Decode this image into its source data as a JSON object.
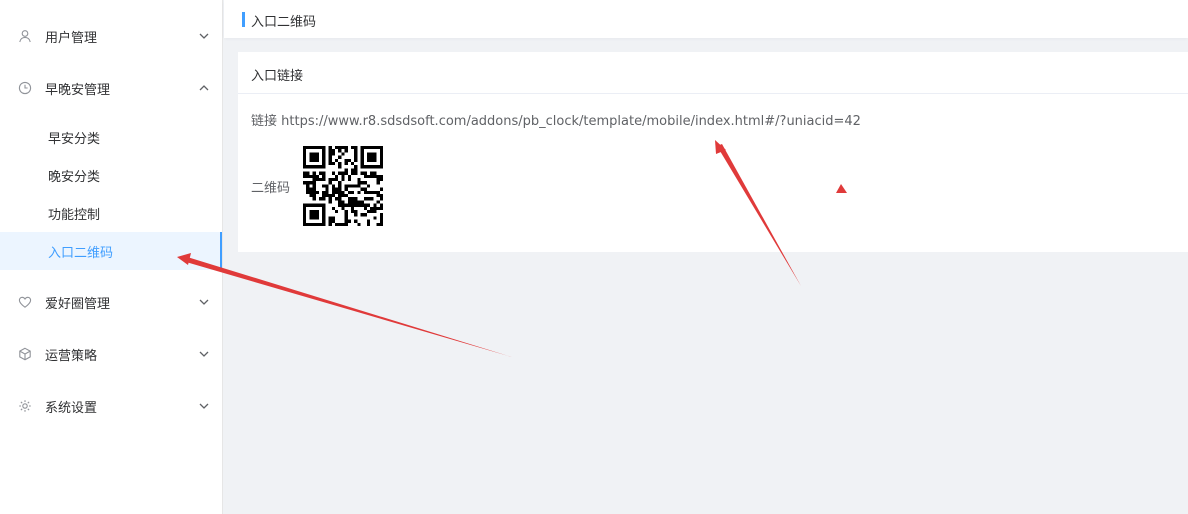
{
  "sidebar": {
    "groups": [
      {
        "label": "用户管理",
        "icon": "user-icon",
        "expanded": false
      },
      {
        "label": "早晚安管理",
        "icon": "clock-icon",
        "expanded": true
      },
      {
        "label": "爱好圈管理",
        "icon": "heart-icon",
        "expanded": false
      },
      {
        "label": "运营策略",
        "icon": "cube-icon",
        "expanded": false
      },
      {
        "label": "系统设置",
        "icon": "gear-icon",
        "expanded": false
      }
    ],
    "sub_items": [
      {
        "label": "早安分类"
      },
      {
        "label": "晚安分类"
      },
      {
        "label": "功能控制"
      },
      {
        "label": "入口二维码",
        "active": true
      }
    ]
  },
  "header": {
    "title": "入口二维码"
  },
  "card": {
    "title": "入口链接",
    "link_label": "链接",
    "link_url": "https://www.r8.sdsdsoft.com/addons/pb_clock/template/mobile/index.html#/?uniacid=42",
    "qr_label": "二维码"
  },
  "colors": {
    "accent": "#409eff",
    "annotation": "#e03a3a"
  }
}
